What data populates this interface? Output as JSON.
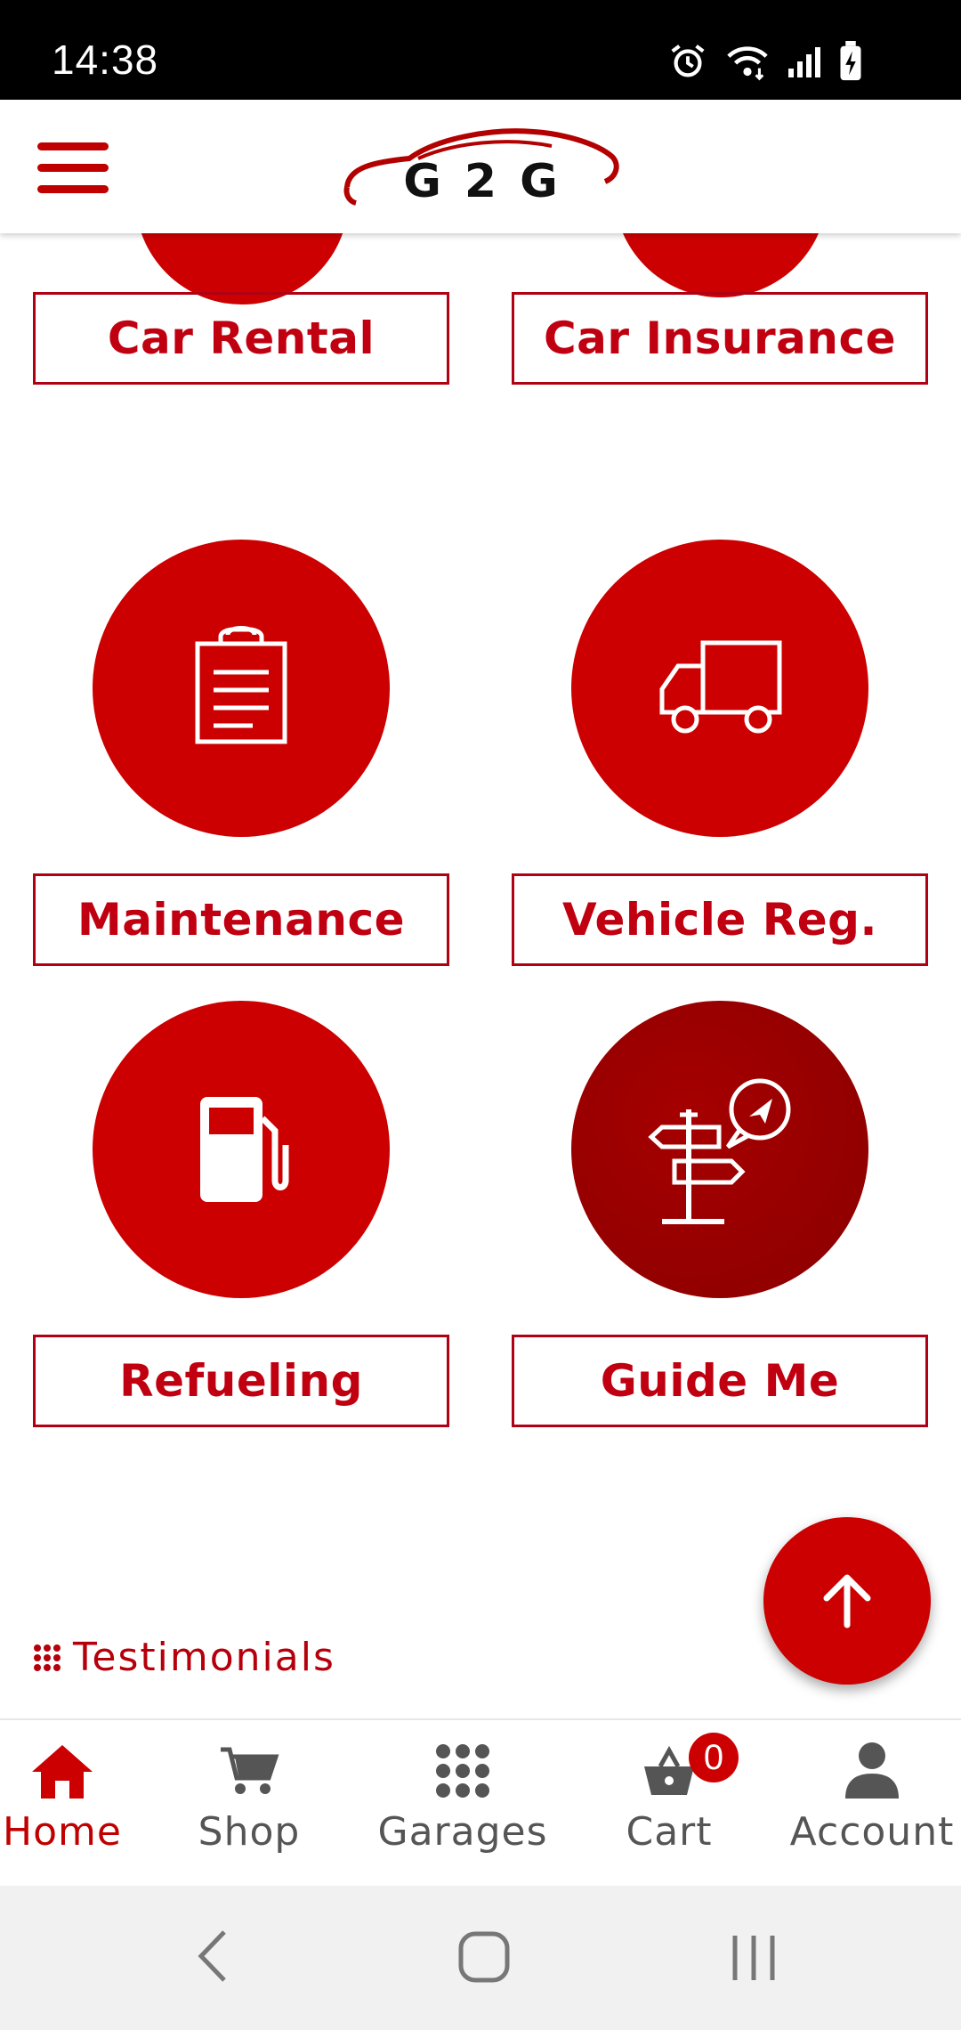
{
  "status_bar": {
    "time": "14:38"
  },
  "header": {
    "logo_text": "G2G"
  },
  "services": {
    "car_rental": "Car Rental",
    "car_insurance": "Car Insurance",
    "maintenance": "Maintenance",
    "vehicle_reg": "Vehicle Reg.",
    "refueling": "Refueling",
    "guide_me": "Guide Me"
  },
  "testimonials": {
    "title": "Testimonials"
  },
  "bottom_nav": {
    "items": [
      {
        "label": "Home",
        "icon": "home-icon",
        "active": true
      },
      {
        "label": "Shop",
        "icon": "cart-icon"
      },
      {
        "label": "Garages",
        "icon": "grid-dots-icon"
      },
      {
        "label": "Cart",
        "icon": "basket-icon"
      },
      {
        "label": "Account",
        "icon": "user-icon"
      }
    ],
    "cart_count": "0"
  },
  "colors": {
    "primary": "#cc0000",
    "primary_dark": "#8a0000",
    "text_muted": "#555555"
  }
}
